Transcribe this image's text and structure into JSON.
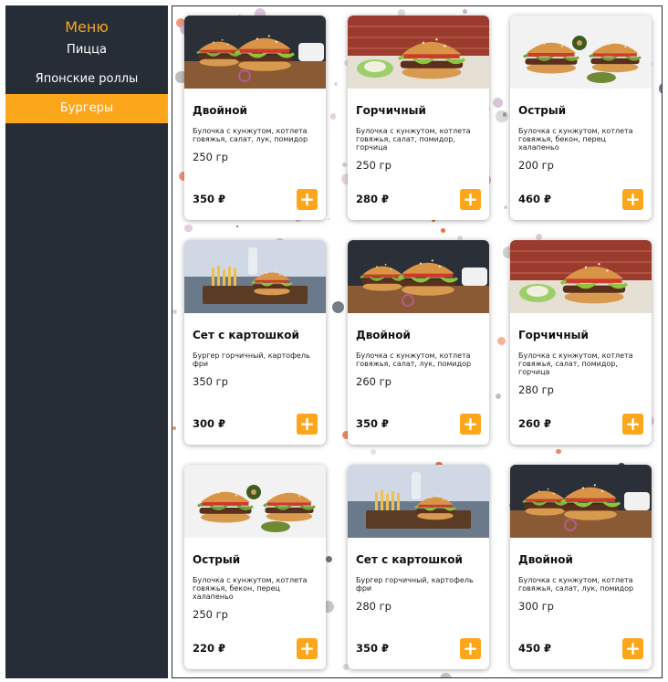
{
  "sidebar": {
    "title": "Меню",
    "items": [
      {
        "label": "Пицца",
        "active": false
      },
      {
        "label": "Японские роллы",
        "active": false
      },
      {
        "label": "Бургеры",
        "active": true
      }
    ]
  },
  "products": [
    {
      "name": "Двойной",
      "desc": "Булочка с кунжутом, котлета говяжья, салат, лук, помидор",
      "weight": "250 гр",
      "price": "350 ₽",
      "image": "double-burger-photo"
    },
    {
      "name": "Горчичный",
      "desc": "Булочка с кунжутом, котлета говяжья, салат, помидор, горчица",
      "weight": "250 гр",
      "price": "280 ₽",
      "image": "mustard-burger-photo"
    },
    {
      "name": "Острый",
      "desc": "Булочка с кунжутом, котлета говяжья, бекон, перец халапеньо",
      "weight": "200 гр",
      "price": "460 ₽",
      "image": "spicy-burger-photo"
    },
    {
      "name": "Сет с картошкой",
      "desc": "Бургер горчичный, картофель фри",
      "weight": "350 гр",
      "price": "300 ₽",
      "image": "burger-set-photo"
    },
    {
      "name": "Двойной",
      "desc": "Булочка с кунжутом, котлета говяжья, салат, лук, помидор",
      "weight": "260 гр",
      "price": "350 ₽",
      "image": "double-burger-photo"
    },
    {
      "name": "Горчичный",
      "desc": "Булочка с кунжутом, котлета говяжья, салат, помидор, горчица",
      "weight": "280 гр",
      "price": "260 ₽",
      "image": "mustard-burger-photo"
    },
    {
      "name": "Острый",
      "desc": "Булочка с кунжутом, котлета говяжья, бекон, перец халапеньо",
      "weight": "250 гр",
      "price": "220 ₽",
      "image": "spicy-burger-photo"
    },
    {
      "name": "Сет с картошкой",
      "desc": "Бургер горчичный, картофель фри",
      "weight": "280 гр",
      "price": "350 ₽",
      "image": "burger-set-photo"
    },
    {
      "name": "Двойной",
      "desc": "Булочка с кунжутом, котлета говяжья, салат, лук, помидор",
      "weight": "300 гр",
      "price": "450 ₽",
      "image": "double-burger-photo"
    }
  ],
  "add_label": "+",
  "colors": {
    "sidebar": "#262d37",
    "accent": "#fba61b",
    "title": "#f5a623"
  }
}
